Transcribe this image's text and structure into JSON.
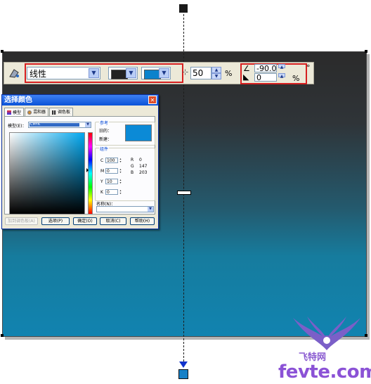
{
  "toolbar": {
    "fill_type": "线性",
    "start_color": "#222222",
    "end_color": "#0b82cc",
    "midpoint": "50",
    "percent_symbol": "%",
    "angle": "-90.0",
    "degree_symbol": "°",
    "edge_pad": "0",
    "edge_pad_unit": "%"
  },
  "canvas": {
    "gradient_start": "#2b2b2b",
    "gradient_end": "#1183b0"
  },
  "dialog": {
    "title": "选择颜色",
    "tabs": [
      "模型",
      "混和器",
      "调色板"
    ],
    "model_label": "模型(E)：",
    "model_value": "CMYK",
    "reference_label": "参考",
    "old_label": "旧的：",
    "new_label": "新建：",
    "preview_color": "#0b8ad6",
    "components_label": "组件",
    "cmyk": [
      {
        "label": "C",
        "value": "100"
      },
      {
        "label": "M",
        "value": "0"
      },
      {
        "label": "Y",
        "value": "10"
      },
      {
        "label": "K",
        "value": "0"
      }
    ],
    "rgb": [
      {
        "label": "R",
        "value": "0"
      },
      {
        "label": "G",
        "value": "147"
      },
      {
        "label": "B",
        "value": "203"
      }
    ],
    "name_label": "名称(N)：",
    "buttons": {
      "add_palette": "加到调色板(A)",
      "options": "选项(P)",
      "ok": "确定(O)",
      "cancel": "取消(C)",
      "help": "帮助(H)"
    }
  },
  "watermark": {
    "brand": "飞特网",
    "site": "fevte.com"
  }
}
